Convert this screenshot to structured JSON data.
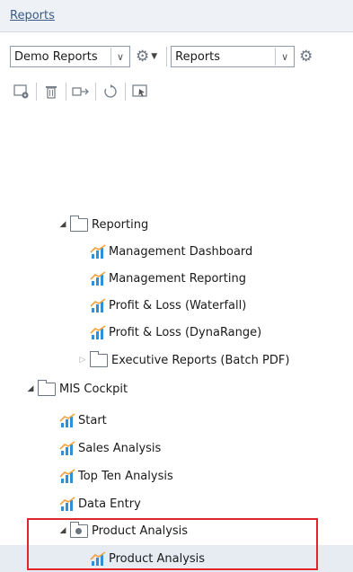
{
  "panel": {
    "title": "Reports"
  },
  "selectors": {
    "left": {
      "value": "Demo Reports"
    },
    "right": {
      "value": "Reports"
    }
  },
  "toolbar": {
    "icons": [
      "new-report-icon",
      "delete-icon",
      "move-icon",
      "refresh-icon",
      "select-icon"
    ]
  },
  "tree": {
    "reporting": {
      "label": "Reporting"
    },
    "reporting_items": [
      {
        "label": "Management Dashboard"
      },
      {
        "label": "Management Reporting"
      },
      {
        "label": "Profit & Loss (Waterfall)"
      },
      {
        "label": "Profit & Loss (DynaRange)"
      }
    ],
    "executive": {
      "label": "Executive Reports (Batch PDF)"
    },
    "mis": {
      "label": "MIS Cockpit"
    },
    "mis_items": [
      {
        "label": "Start"
      },
      {
        "label": "Sales Analysis"
      },
      {
        "label": "Top Ten Analysis"
      },
      {
        "label": "Data Entry"
      }
    ],
    "product_folder": {
      "label": "Product Analysis"
    },
    "product_item": {
      "label": "Product Analysis"
    }
  },
  "colors": {
    "highlight_border": "#e0262b",
    "selection_bg": "#e7ecf3",
    "report_icon_blue": "#2f8fd8",
    "report_icon_orange": "#f2a33a"
  }
}
